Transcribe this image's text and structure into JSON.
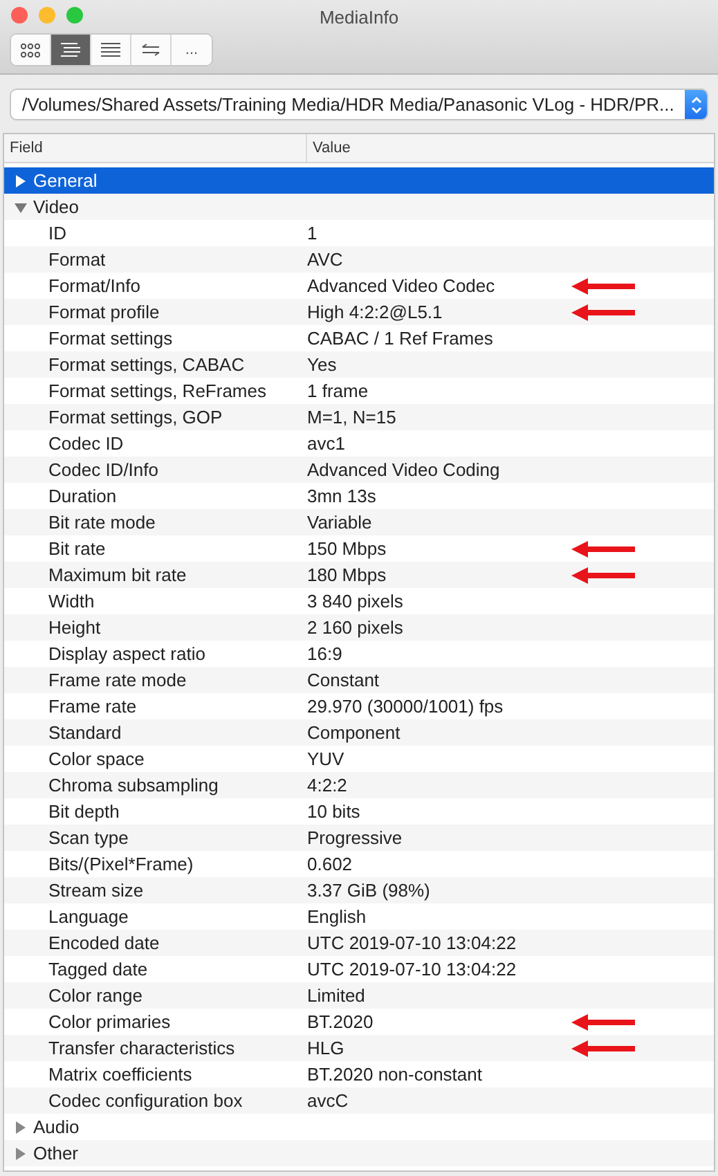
{
  "window": {
    "title": "MediaInfo"
  },
  "toolbar": [
    {
      "kind": "grid",
      "selected": false
    },
    {
      "kind": "tree",
      "selected": true
    },
    {
      "kind": "text",
      "selected": false
    },
    {
      "kind": "compare",
      "selected": false
    },
    {
      "kind": "more",
      "label": "...",
      "selected": false
    }
  ],
  "path": {
    "value": "/Volumes/Shared Assets/Training Media/HDR Media/Panasonic VLog - HDR/PR..."
  },
  "table": {
    "columns": [
      "Field",
      "Value"
    ],
    "sections": [
      {
        "name": "General",
        "expanded": false,
        "selected": true
      },
      {
        "name": "Video",
        "expanded": true,
        "selected": false,
        "rows": [
          {
            "field": "ID",
            "value": "1",
            "marked": false
          },
          {
            "field": "Format",
            "value": "AVC",
            "marked": false
          },
          {
            "field": "Format/Info",
            "value": "Advanced Video Codec",
            "marked": true
          },
          {
            "field": "Format profile",
            "value": "High 4:2:2@L5.1",
            "marked": true
          },
          {
            "field": "Format settings",
            "value": "CABAC / 1 Ref Frames",
            "marked": false
          },
          {
            "field": "Format settings, CABAC",
            "value": "Yes",
            "marked": false
          },
          {
            "field": "Format settings, ReFrames",
            "value": "1 frame",
            "marked": false
          },
          {
            "field": "Format settings, GOP",
            "value": "M=1, N=15",
            "marked": false
          },
          {
            "field": "Codec ID",
            "value": "avc1",
            "marked": false
          },
          {
            "field": "Codec ID/Info",
            "value": "Advanced Video Coding",
            "marked": false
          },
          {
            "field": "Duration",
            "value": "3mn 13s",
            "marked": false
          },
          {
            "field": "Bit rate mode",
            "value": "Variable",
            "marked": false
          },
          {
            "field": "Bit rate",
            "value": "150 Mbps",
            "marked": true
          },
          {
            "field": "Maximum bit rate",
            "value": "180 Mbps",
            "marked": true
          },
          {
            "field": "Width",
            "value": "3 840 pixels",
            "marked": false
          },
          {
            "field": "Height",
            "value": "2 160 pixels",
            "marked": false
          },
          {
            "field": "Display aspect ratio",
            "value": "16:9",
            "marked": false
          },
          {
            "field": "Frame rate mode",
            "value": "Constant",
            "marked": false
          },
          {
            "field": "Frame rate",
            "value": "29.970 (30000/1001) fps",
            "marked": false
          },
          {
            "field": "Standard",
            "value": "Component",
            "marked": false
          },
          {
            "field": "Color space",
            "value": "YUV",
            "marked": false
          },
          {
            "field": "Chroma subsampling",
            "value": "4:2:2",
            "marked": false
          },
          {
            "field": "Bit depth",
            "value": "10 bits",
            "marked": false
          },
          {
            "field": "Scan type",
            "value": "Progressive",
            "marked": false
          },
          {
            "field": "Bits/(Pixel*Frame)",
            "value": "0.602",
            "marked": false
          },
          {
            "field": "Stream size",
            "value": "3.37 GiB (98%)",
            "marked": false
          },
          {
            "field": "Language",
            "value": "English",
            "marked": false
          },
          {
            "field": "Encoded date",
            "value": "UTC 2019-07-10 13:04:22",
            "marked": false
          },
          {
            "field": "Tagged date",
            "value": "UTC 2019-07-10 13:04:22",
            "marked": false
          },
          {
            "field": "Color range",
            "value": "Limited",
            "marked": false
          },
          {
            "field": "Color primaries",
            "value": "BT.2020",
            "marked": true
          },
          {
            "field": "Transfer characteristics",
            "value": "HLG",
            "marked": true
          },
          {
            "field": "Matrix coefficients",
            "value": "BT.2020 non-constant",
            "marked": false
          },
          {
            "field": "Codec configuration box",
            "value": "avcC",
            "marked": false
          }
        ]
      },
      {
        "name": "Audio",
        "expanded": false,
        "selected": false
      },
      {
        "name": "Other",
        "expanded": false,
        "selected": false
      }
    ]
  }
}
